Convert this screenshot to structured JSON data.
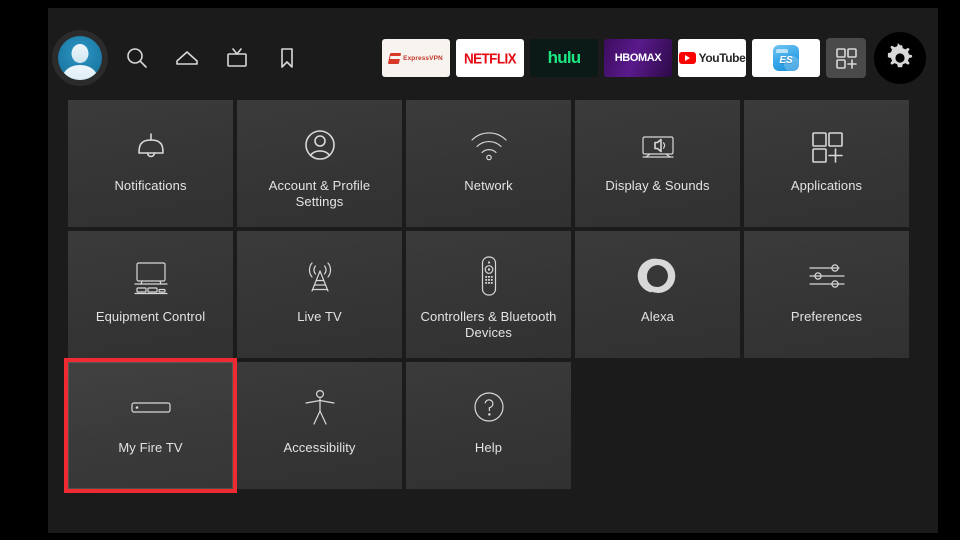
{
  "screen": {
    "device": "Fire TV",
    "page_title": "Settings"
  },
  "top_nav": {
    "profile": {
      "name": "profile-avatar",
      "label": "Profile"
    },
    "icons": [
      {
        "name": "search-icon",
        "label": "Search"
      },
      {
        "name": "home-icon",
        "label": "Home"
      },
      {
        "name": "live-tv-icon",
        "label": "Live TV"
      },
      {
        "name": "bookmark-icon",
        "label": "Library"
      }
    ],
    "apps": [
      {
        "name": "expressvpn-app",
        "label": "ExpressVPN"
      },
      {
        "name": "netflix-app",
        "label": "NETFLIX"
      },
      {
        "name": "hulu-app",
        "label": "hulu"
      },
      {
        "name": "hbomax-app",
        "label": "HBOMAX"
      },
      {
        "name": "youtube-app",
        "label": "YouTube"
      },
      {
        "name": "es-file-explorer-app",
        "label": "ES"
      }
    ],
    "apps_button": {
      "name": "add-apps-button",
      "label": "Apps +"
    },
    "settings_button": {
      "name": "settings-gear-button",
      "label": "Settings"
    }
  },
  "settings": {
    "rows": [
      [
        {
          "label": "Notifications",
          "icon": "bell-icon",
          "selected": false
        },
        {
          "label": "Account & Profile Settings",
          "icon": "account-profile-icon",
          "selected": false
        },
        {
          "label": "Network",
          "icon": "wifi-icon",
          "selected": false
        },
        {
          "label": "Display & Sounds",
          "icon": "display-sounds-icon",
          "selected": false
        },
        {
          "label": "Applications",
          "icon": "applications-grid-icon",
          "selected": false
        }
      ],
      [
        {
          "label": "Equipment Control",
          "icon": "equipment-control-icon",
          "selected": false
        },
        {
          "label": "Live TV",
          "icon": "antenna-icon",
          "selected": false
        },
        {
          "label": "Controllers & Bluetooth Devices",
          "icon": "remote-control-icon",
          "selected": false
        },
        {
          "label": "Alexa",
          "icon": "alexa-icon",
          "selected": false
        },
        {
          "label": "Preferences",
          "icon": "sliders-icon",
          "selected": false
        }
      ],
      [
        {
          "label": "My Fire TV",
          "icon": "fire-tv-stick-icon",
          "selected": true
        },
        {
          "label": "Accessibility",
          "icon": "accessibility-icon",
          "selected": false
        },
        {
          "label": "Help",
          "icon": "help-question-icon",
          "selected": false
        }
      ]
    ]
  },
  "colors": {
    "selection_red": "#ef2a32",
    "tile_background": "#363636",
    "surface_background": "#1b1b1b",
    "frame_black": "#000000",
    "icon_stroke": "#d8d8d8",
    "netflix_red": "#e50914",
    "hulu_green": "#1ce783",
    "avatar_blue": "#2389b8"
  }
}
